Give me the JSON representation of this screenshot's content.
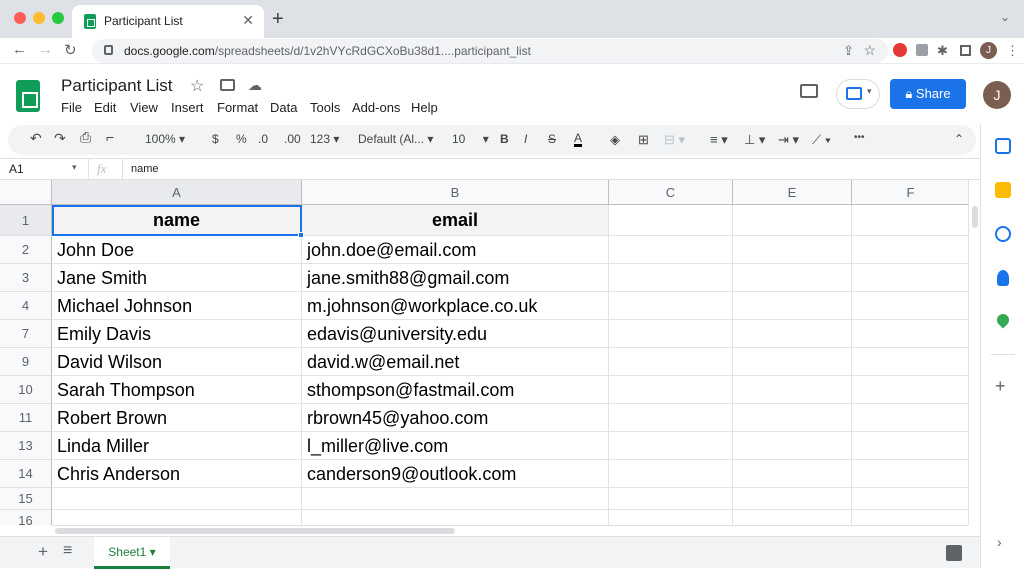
{
  "browser": {
    "tab_title": "Participant List",
    "tab_close": "✕",
    "new_tab": "+",
    "url_host": "docs.google.com",
    "url_path": "/spreadsheets/d/1v2hVYcRdGCXoBu38d1....participant_list",
    "back": "←",
    "forward": "→",
    "reload": "↻"
  },
  "app": {
    "doc_title": "Participant List",
    "menu": [
      "File",
      "Edit",
      "View",
      "Insert",
      "Format",
      "Data",
      "Tools",
      "Add-ons",
      "Help"
    ],
    "share_label": "Share",
    "avatar_initial": "J",
    "brand_color": "#0f9d58",
    "accent_color": "#1a73e8"
  },
  "toolbar": {
    "zoom": "100%",
    "currency": "$",
    "percent": "%",
    "dec_decrease": ".0",
    "dec_increase": ".00",
    "more_formats": "123",
    "font": "Default (Al...",
    "font_size": "10",
    "bold": "B",
    "italic": "I",
    "strike": "S",
    "text_color": "A",
    "more": "•••"
  },
  "formula_bar": {
    "cell_ref": "A1",
    "fx": "fx",
    "value": "name"
  },
  "columns": [
    "A",
    "B",
    "C",
    "E",
    "F"
  ],
  "rows": [
    {
      "num": "1",
      "a": "name",
      "b": "email"
    },
    {
      "num": "2",
      "a": "John Doe",
      "b": "john.doe@email.com"
    },
    {
      "num": "3",
      "a": "Jane Smith",
      "b": "jane.smith88@gmail.com"
    },
    {
      "num": "4",
      "a": "Michael Johnson",
      "b": "m.johnson@workplace.co.uk"
    },
    {
      "num": "7",
      "a": "Emily Davis",
      "b": "edavis@university.edu"
    },
    {
      "num": "9",
      "a": "David Wilson",
      "b": "david.w@email.net"
    },
    {
      "num": "10",
      "a": "Sarah Thompson",
      "b": "sthompson@fastmail.com"
    },
    {
      "num": "11",
      "a": "Robert Brown",
      "b": "rbrown45@yahoo.com"
    },
    {
      "num": "13",
      "a": "Linda Miller",
      "b": "l_miller@live.com"
    },
    {
      "num": "14",
      "a": "Chris Anderson",
      "b": "canderson9@outlook.com"
    },
    {
      "num": "15",
      "a": "",
      "b": ""
    },
    {
      "num": "16",
      "a": "",
      "b": ""
    }
  ],
  "sheet": {
    "add": "+",
    "list": "≡",
    "name": "Sheet1",
    "dropdown": "▾"
  }
}
